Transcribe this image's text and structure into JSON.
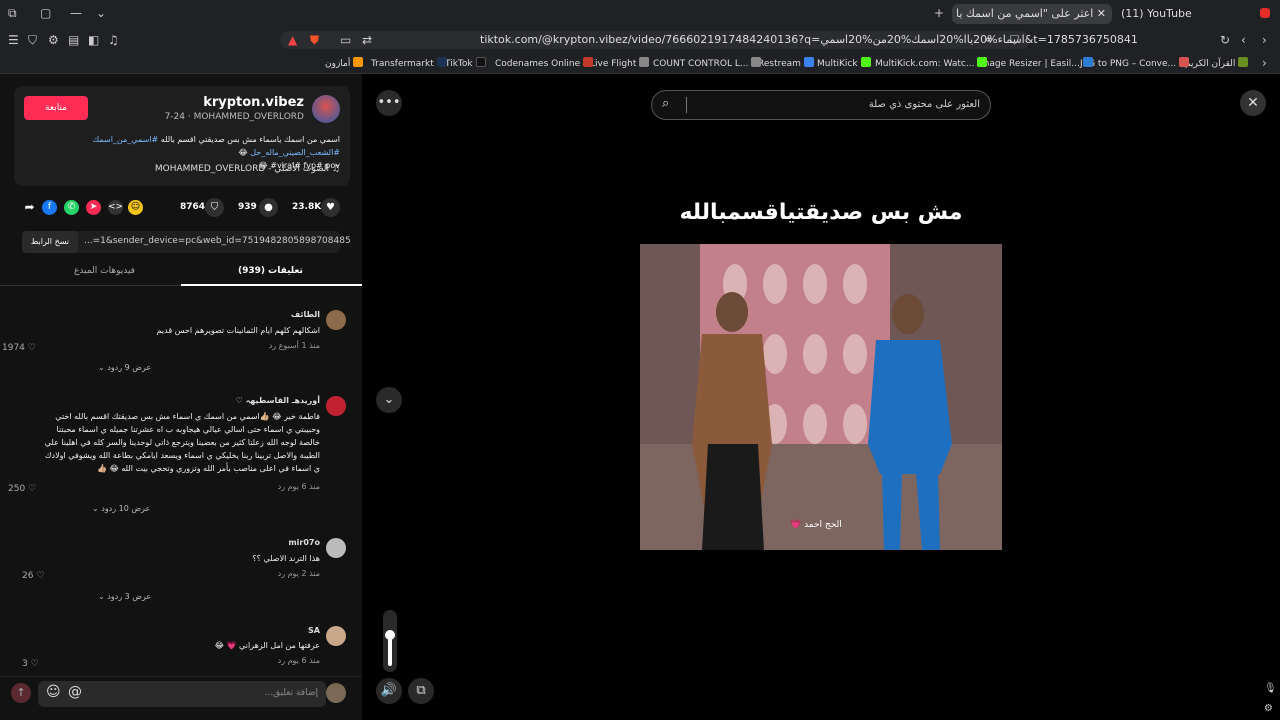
{
  "browser": {
    "tabs": [
      {
        "label": "(11) YouTube",
        "active": false
      },
      {
        "label": "اعثر على \"اسمي من اسمك يا ا...",
        "active": true
      }
    ],
    "url": "tiktok.com/@krypton.vibez/video/7666021917484240136?q=اسماء%20ياا%20اسمك%20من%20اسمي&t=1785736750841",
    "bookmarks": [
      {
        "label": "القرآن الكريم",
        "color": "#6b8e23"
      },
      {
        "label": "JPG to PNG – Conve...",
        "color": "#d9534f"
      },
      {
        "label": "Image Resizer | Easil...",
        "color": "#2d7dd2"
      },
      {
        "label": "MultiKick.com: Watc...",
        "color": "#53fc18"
      },
      {
        "label": "MultiKick",
        "color": "#53fc18"
      },
      {
        "label": "Restream",
        "color": "#3b82f6"
      },
      {
        "label": "COUNT CONTROL L...",
        "color": "#888888"
      },
      {
        "label": "Live Flight",
        "color": "#888888"
      },
      {
        "label": "Codenames Online",
        "color": "#c0392b"
      },
      {
        "label": "TikTok",
        "color": "#111111"
      },
      {
        "label": "Transfermarkt",
        "color": "#1a3151"
      },
      {
        "label": "أمازون",
        "color": "#ff9900"
      }
    ]
  },
  "post": {
    "follow_label": "متابعة",
    "username": "krypton.vibez",
    "subline": "7-24 · MOHAMMED_OVERLORD",
    "description_plain": "اسمي من اسمك ياسماء مش بس صديقتي اقسم بالله ",
    "description_tags": "#اسمي_من_اسمك #الشعب_الصيني_ماله_حل",
    "description_tags2": "#viral# fyp# pov",
    "music": "الصوت الأصلي - MOHAMMED_OVERLORD",
    "likes": "23.8K",
    "comments": "939",
    "saves": "8764",
    "copy_label": "نسخ الرابط",
    "link": "...=1&sender_device=pc&web_id=7519482805898708485"
  },
  "tabs": {
    "comments": "تعليقات (939)",
    "creator_videos": "فيديوهات المبدع"
  },
  "comments": [
    {
      "name": "الطائف",
      "text": "اشكالهم كلهم ايام الثمانينات تصويرهم احس قديم",
      "meta": "منذ 1 أسبوع   رد",
      "likes": "1974",
      "replies": "عرض 9 ردود"
    },
    {
      "name": "أوريدهـ الفاسطيهہ ♡",
      "text": "فاطمة خير 😂 👍🏼اسمي من اسمك ي اسماء مش بس صديقتك اقسم بالله اختي وحبيبتي ي اسماء حتى اسالي عيالي هيجاوبه ب اه عشرتنا جميله ي اسماء محبتنا خالصة لوجه الله زعلنا كثير من بعضينا ويترجع ذاتي لوحدينا والسر كله في اهلينا علي الطيبة والاصل تربينا ربنا يخليكي ي اسماء ويسعد ايامكي بطاعة الله ويشوفي اولادك ي اسماء في اعلى مناصب بأمر الله وتزوري وتحجي بيت الله 😂 👍🏼",
      "meta": "منذ 6 يوم   رد",
      "likes": "250",
      "replies": "عرض 10 ردود"
    },
    {
      "name": "mir07o",
      "text": "هذا الترند الاصلي ؟؟",
      "meta": "منذ 2 يوم   رد",
      "likes": "26",
      "replies": "عرض 3 ردود"
    },
    {
      "name": "SA",
      "text": "عرفتها من امل الزهراني 💗 😂",
      "meta": "منذ 6 يوم   رد",
      "likes": "3",
      "replies": ""
    }
  ],
  "input": {
    "placeholder": "إضافة تعليق..."
  },
  "video": {
    "search_placeholder": "العثور على محتوى ذي صلة",
    "caption": "مش بس صديقتياقسمبالله",
    "watermark": "الحج احمد 💗"
  },
  "volume_level": 0.62
}
